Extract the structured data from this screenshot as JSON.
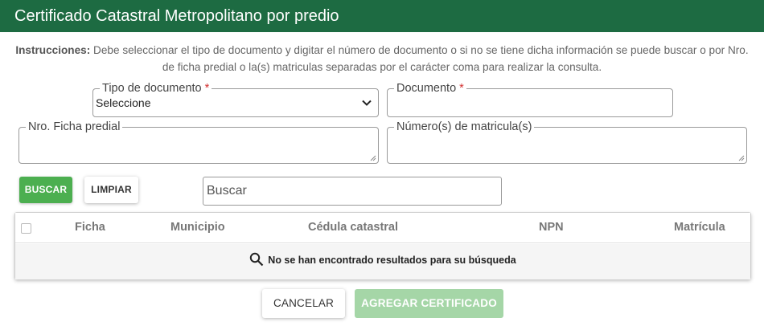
{
  "header": {
    "title": "Certificado Catastral Metropolitano por predio"
  },
  "instructions": {
    "label": "Instrucciones:",
    "text": " Debe seleccionar el tipo de documento y digitar el número de documento o si no se tiene dicha información se puede buscar o por Nro. de ficha predial o la(s) matriculas separadas por el carácter coma para realizar la consulta."
  },
  "form": {
    "tipo_documento": {
      "label": "Tipo de documento",
      "required_mark": "*",
      "value": "Seleccione"
    },
    "documento": {
      "label": "Documento",
      "required_mark": "*",
      "value": ""
    },
    "ficha_predial": {
      "label": "Nro. Ficha predial",
      "value": ""
    },
    "matriculas": {
      "label": "Número(s) de matricula(s)",
      "value": ""
    }
  },
  "actions": {
    "buscar": "BUSCAR",
    "limpiar": "LIMPIAR"
  },
  "search": {
    "placeholder": "Buscar",
    "value": ""
  },
  "table": {
    "columns": [
      "Ficha",
      "Municipio",
      "Cédula catastral",
      "NPN",
      "Matrícula"
    ],
    "empty_message": "No se han encontrado resultados para su búsqueda"
  },
  "footer": {
    "cancelar": "CANCELAR",
    "agregar": "AGREGAR CERTIFICADO"
  },
  "colors": {
    "header_bg": "#1d6b42",
    "primary_green": "#4caf50",
    "disabled_green": "#a5d6a7",
    "required": "#d32f2f"
  },
  "icons": {
    "select_arrow": "chevron-down-icon",
    "empty_search": "search-icon"
  }
}
